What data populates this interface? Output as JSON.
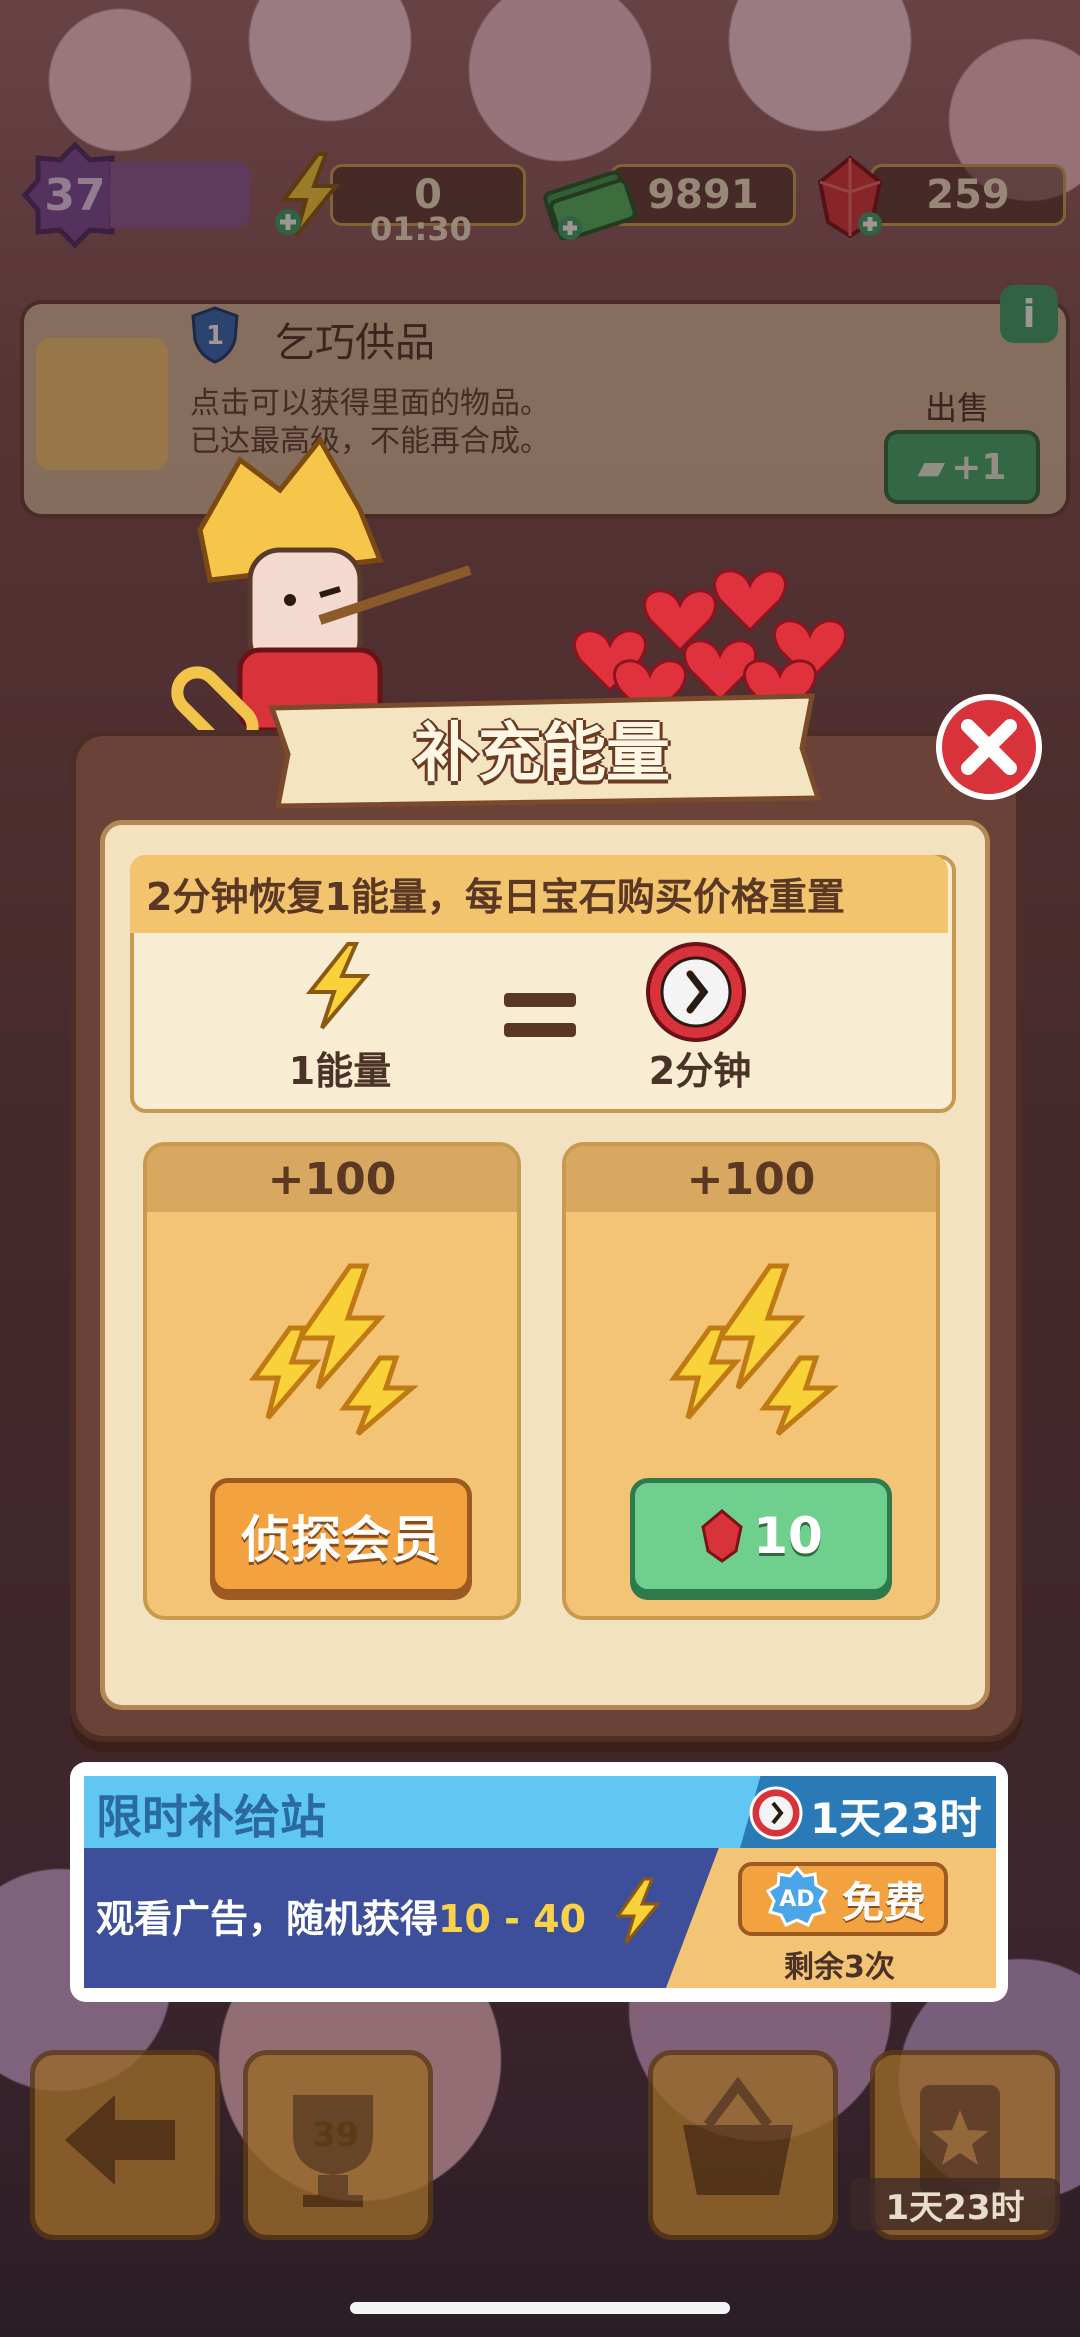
{
  "hud": {
    "level": "37",
    "energy": "0",
    "energy_timer": "01:30",
    "cash": "9891",
    "gems": "259"
  },
  "item_card": {
    "title": "乞巧供品",
    "desc_line1": "点击可以获得里面的物品。",
    "desc_line2": "已达最高级，不能再合成。",
    "info_label": "i",
    "sell_label": "出售",
    "sell_value": "+1"
  },
  "dialog": {
    "title": "补充能量",
    "rate_text": "2分钟恢复1能量，每日宝石购买价格重置",
    "energy_unit_label": "1能量",
    "time_unit_label": "2分钟",
    "offers": [
      {
        "amount": "+100",
        "button_label": "侦探会员"
      },
      {
        "amount": "+100",
        "button_label": "10"
      }
    ]
  },
  "supply_station": {
    "title": "限时补给站",
    "timer": "1天23时",
    "text_prefix": "观看广告，随机获得",
    "text_range": "10 - 40",
    "ad_label": "AD",
    "button_label": "免费",
    "remaining": "剩余3次"
  },
  "dock": {
    "trophy_count": "39",
    "timer": "1天23时"
  },
  "colors": {
    "accent_orange": "#f2a23f",
    "accent_green": "#6fd08d",
    "close_red": "#d8333a",
    "supply_blue": "#5fc7f2"
  }
}
